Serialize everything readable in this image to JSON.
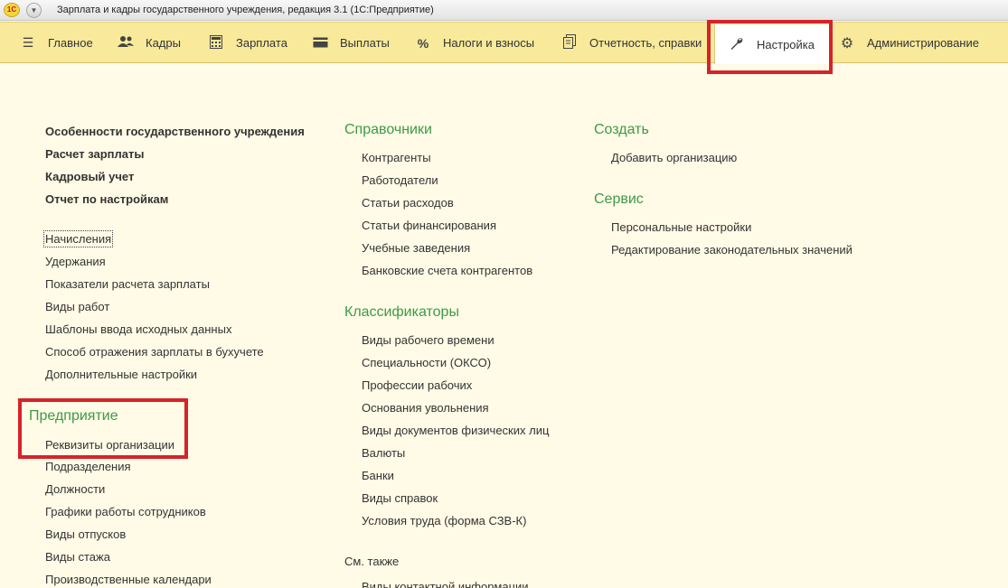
{
  "window": {
    "title": "Зарплата и кадры государственного учреждения, редакция 3.1  (1С:Предприятие)",
    "logo_text": "1С",
    "menu_icon": "chevron-down-icon"
  },
  "sections": [
    {
      "label": "Главное",
      "icon": "hamburger-icon"
    },
    {
      "label": "Кадры",
      "icon": "people-icon"
    },
    {
      "label": "Зарплата",
      "icon": "calculator-icon"
    },
    {
      "label": "Выплаты",
      "icon": "wallet-icon"
    },
    {
      "label": "Налоги и взносы",
      "icon": "percent-icon"
    },
    {
      "label": "Отчетность, справки",
      "icon": "documents-icon"
    },
    {
      "label": "Настройка",
      "icon": "wrench-icon",
      "active": true
    },
    {
      "label": "Администрирование",
      "icon": "gear-icon"
    }
  ],
  "col1": {
    "bold_links": [
      "Особенности государственного учреждения",
      "Расчет зарплаты",
      "Кадровый учет",
      "Отчет по настройкам"
    ],
    "links": [
      "Начисления",
      "Удержания",
      "Показатели расчета зарплаты",
      "Виды работ",
      "Шаблоны ввода исходных данных",
      "Способ отражения зарплаты в бухучете",
      "Дополнительные настройки"
    ],
    "enterprise": {
      "title": "Предприятие",
      "links": [
        "Реквизиты организации",
        "Подразделения",
        "Должности",
        "Графики работы сотрудников",
        "Виды отпусков",
        "Виды стажа",
        "Производственные календари"
      ]
    }
  },
  "col2": {
    "directories": {
      "title": "Справочники",
      "links": [
        "Контрагенты",
        "Работодатели",
        "Статьи расходов",
        "Статьи финансирования",
        "Учебные заведения",
        "Банковские счета контрагентов"
      ]
    },
    "classifiers": {
      "title": "Классификаторы",
      "links": [
        "Виды рабочего времени",
        "Специальности (ОКСО)",
        "Профессии рабочих",
        "Основания увольнения",
        "Виды документов физических лиц",
        "Валюты",
        "Банки",
        "Виды справок",
        "Условия труда (форма СЗВ-К)"
      ]
    },
    "see_also": {
      "title": "См. также",
      "links": [
        "Виды контактной информации"
      ]
    }
  },
  "col3": {
    "create": {
      "title": "Создать",
      "links": [
        "Добавить организацию"
      ]
    },
    "service": {
      "title": "Сервис",
      "links": [
        "Персональные настройки",
        "Редактирование законодательных значений"
      ]
    }
  },
  "colors": {
    "accent_green": "#3d9a48",
    "section_bar": "#f8e99b",
    "content_bg": "#fffbe6",
    "highlight_red": "#d5232a"
  }
}
